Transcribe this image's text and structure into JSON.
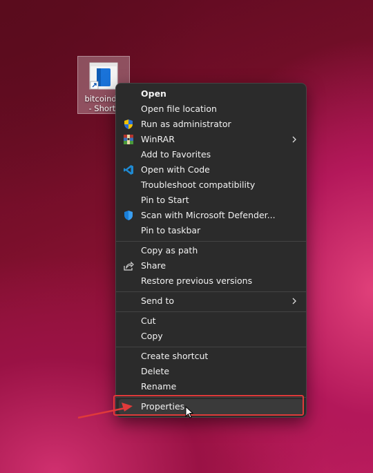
{
  "desktop": {
    "icon_label_line1": "bitcoind.e",
    "icon_label_line2": "- Shortc",
    "icon_name": "shortcut-file-icon"
  },
  "menu": {
    "items": [
      {
        "label": "Open",
        "icon": "",
        "bold": true
      },
      {
        "label": "Open file location",
        "icon": ""
      },
      {
        "label": "Run as administrator",
        "icon": "uac-shield-icon"
      },
      {
        "label": "WinRAR",
        "icon": "winrar-icon",
        "submenu": true
      },
      {
        "label": "Add to Favorites",
        "icon": ""
      },
      {
        "label": "Open with Code",
        "icon": "vscode-icon"
      },
      {
        "label": "Troubleshoot compatibility",
        "icon": ""
      },
      {
        "label": "Pin to Start",
        "icon": ""
      },
      {
        "label": "Scan with Microsoft Defender...",
        "icon": "defender-shield-icon"
      },
      {
        "label": "Pin to taskbar",
        "icon": ""
      },
      {
        "label": "Copy as path",
        "icon": ""
      },
      {
        "label": "Share",
        "icon": "share-icon"
      },
      {
        "label": "Restore previous versions",
        "icon": ""
      },
      {
        "label": "Send to",
        "icon": "",
        "submenu": true
      },
      {
        "label": "Cut",
        "icon": ""
      },
      {
        "label": "Copy",
        "icon": ""
      },
      {
        "label": "Create shortcut",
        "icon": ""
      },
      {
        "label": "Delete",
        "icon": ""
      },
      {
        "label": "Rename",
        "icon": ""
      },
      {
        "label": "Properties",
        "icon": "",
        "highlighted": true
      }
    ]
  },
  "colors": {
    "menu_bg": "#2b2b2b",
    "text": "#f2f2f2",
    "annotation_red": "#e03a3a"
  }
}
